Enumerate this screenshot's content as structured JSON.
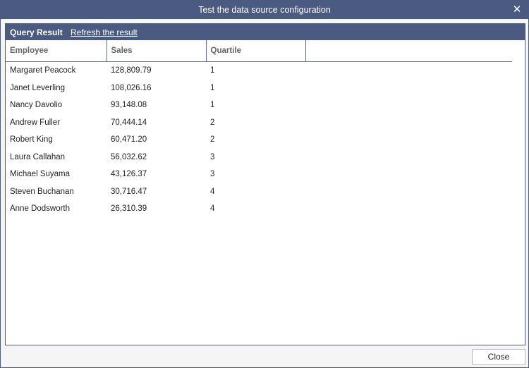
{
  "window": {
    "title": "Test the data source configuration",
    "close_glyph": "✕"
  },
  "panel": {
    "heading": "Query Result",
    "refresh_link": "Refresh the result"
  },
  "table": {
    "columns": [
      "Employee",
      "Sales",
      "Quartile"
    ],
    "rows": [
      [
        "Margaret Peacock",
        "128,809.79",
        "1"
      ],
      [
        "Janet Leverling",
        "108,026.16",
        "1"
      ],
      [
        "Nancy Davolio",
        "93,148.08",
        "1"
      ],
      [
        "Andrew Fuller",
        "70,444.14",
        "2"
      ],
      [
        "Robert King",
        "60,471.20",
        "2"
      ],
      [
        "Laura Callahan",
        "56,032.62",
        "3"
      ],
      [
        "Michael Suyama",
        "43,126.37",
        "3"
      ],
      [
        "Steven Buchanan",
        "30,716.47",
        "4"
      ],
      [
        "Anne Dodsworth",
        "26,310.39",
        "4"
      ]
    ]
  },
  "footer": {
    "close_label": "Close"
  },
  "colors": {
    "accent": "#4a5a80"
  }
}
